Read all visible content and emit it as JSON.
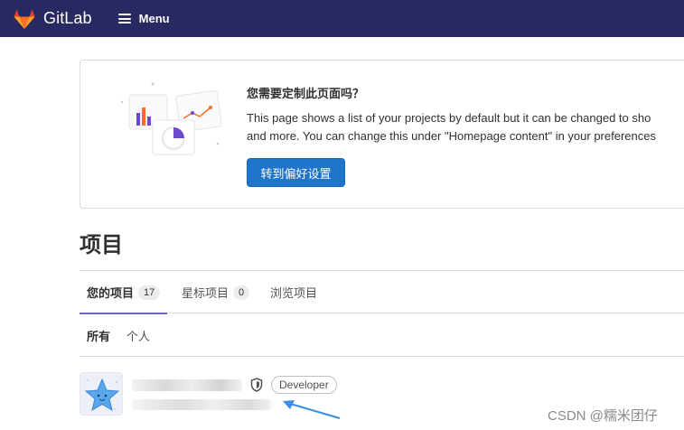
{
  "app": {
    "brand_name": "GitLab",
    "menu_label": "Menu",
    "navbar_color": "#292961"
  },
  "promo": {
    "title": "您需要定制此页面吗？",
    "text_line1": "This page shows a list of your projects by default but it can be changed to sho",
    "text_line2": "and more. You can change this under \"Homepage content\" in your preferences",
    "button_label": "转到偏好设置",
    "button_color": "#1f75cb"
  },
  "page": {
    "title": "项目"
  },
  "tabs": [
    {
      "label": "您的项目",
      "count": "17",
      "active": true
    },
    {
      "label": "星标项目",
      "count": "0",
      "active": false
    },
    {
      "label": "浏览项目",
      "active": false
    }
  ],
  "subtabs": [
    {
      "label": "所有",
      "active": true
    },
    {
      "label": "个人",
      "active": false
    }
  ],
  "project": {
    "role": "Developer",
    "visibility_icon": "shield-icon",
    "avatar_icon": "star-icon"
  },
  "watermark": "CSDN @糯米团仔"
}
